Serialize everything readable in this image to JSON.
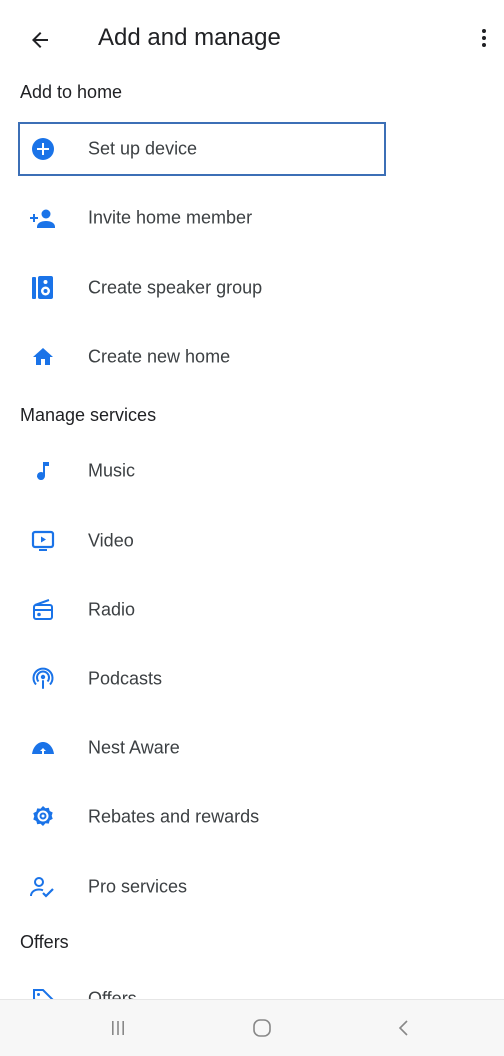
{
  "header": {
    "title": "Add and manage"
  },
  "sections": {
    "add_to_home": {
      "title": "Add to home",
      "items": [
        {
          "label": "Set up device",
          "icon": "add-circle-icon"
        },
        {
          "label": "Invite home member",
          "icon": "person-add-icon"
        },
        {
          "label": "Create speaker group",
          "icon": "speaker-icon"
        },
        {
          "label": "Create new home",
          "icon": "home-icon"
        }
      ]
    },
    "manage_services": {
      "title": "Manage services",
      "items": [
        {
          "label": "Music",
          "icon": "music-note-icon"
        },
        {
          "label": "Video",
          "icon": "video-icon"
        },
        {
          "label": "Radio",
          "icon": "radio-icon"
        },
        {
          "label": "Podcasts",
          "icon": "podcasts-icon"
        },
        {
          "label": "Nest Aware",
          "icon": "nest-aware-icon"
        },
        {
          "label": "Rebates and rewards",
          "icon": "rewards-icon"
        },
        {
          "label": "Pro services",
          "icon": "pro-services-icon"
        }
      ]
    },
    "offers": {
      "title": "Offers",
      "items": [
        {
          "label": "Offers",
          "icon": "offers-icon"
        }
      ]
    }
  },
  "colors": {
    "accent": "#1a73e8",
    "text": "#202124",
    "focus_border": "#3c6fb6"
  }
}
